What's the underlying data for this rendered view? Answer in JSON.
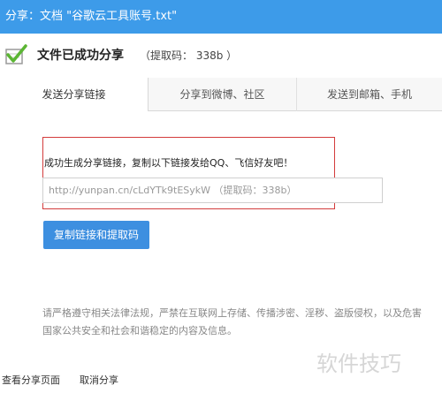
{
  "window": {
    "title": "分享：文档 \"谷歌云工具账号.txt\""
  },
  "header": {
    "title": "文件已成功分享",
    "code": "（提取码： 338b ）"
  },
  "tabs": [
    {
      "label": "发送分享链接",
      "active": true
    },
    {
      "label": "分享到微博、社区",
      "active": false
    },
    {
      "label": "发送到邮箱、手机",
      "active": false
    }
  ],
  "share": {
    "instruction": "成功生成分享链接，复制以下链接发给QQ、飞信好友吧！",
    "link_text": "http://yunpan.cn/cLdYTk9tESykW （提取码：338b）",
    "copy_button": "复制链接和提取码"
  },
  "notice": "请严格遵守相关法律法规，严禁在互联网上存储、传播涉密、淫秽、盗版侵权，以及危害国家公共安全和社会和谐稳定的内容及信息。",
  "footer": {
    "view_link": "查看分享页面",
    "cancel_link": "取消分享"
  },
  "watermark": "软件技巧",
  "colors": {
    "accent": "#3d9be9",
    "button": "#3d8fe0",
    "highlight_border": "#d33c3c",
    "check": "#5bb533"
  },
  "icons": {
    "success": "check-icon"
  }
}
